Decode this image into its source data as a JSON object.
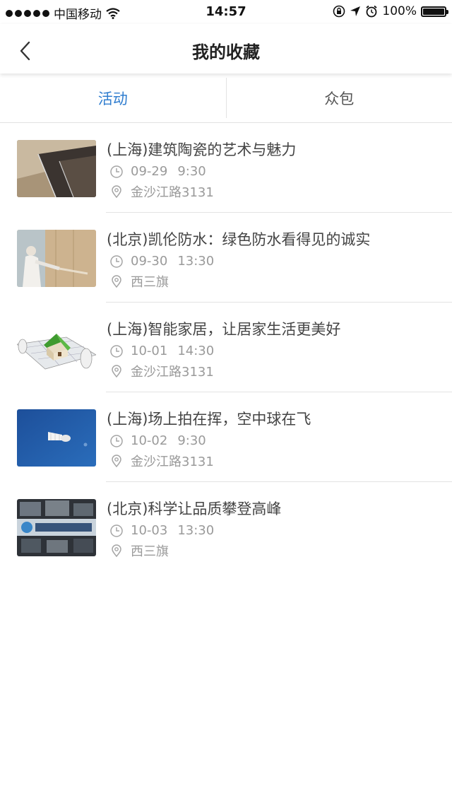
{
  "status_bar": {
    "carrier": "中国移动",
    "time": "14:57",
    "battery": "100%",
    "signal_icon": "signal-dots-icon",
    "wifi_icon": "wifi-icon",
    "orientation_lock_icon": "orientation-lock-icon",
    "location_icon": "location-arrow-icon",
    "alarm_icon": "alarm-icon",
    "battery_icon": "battery-icon"
  },
  "nav": {
    "title": "我的收藏",
    "back_icon": "chevron-left-icon"
  },
  "tabs": [
    {
      "label": "活动",
      "active": true
    },
    {
      "label": "众包",
      "active": false
    }
  ],
  "colors": {
    "accent": "#2f7dcf",
    "text": "#444444",
    "meta": "#9a9a9a",
    "divider": "#e3e3e3"
  },
  "items": [
    {
      "title": "(上海)建筑陶瓷的艺术与魅力",
      "date": "09-29",
      "time": "9:30",
      "location": "金沙江路3131",
      "thumbnail": "ceramic-tiles-image"
    },
    {
      "title": "(北京)凯伦防水：绿色防水看得见的诚实",
      "date": "09-30",
      "time": "13:30",
      "location": "西三旗",
      "thumbnail": "worker-spraying-wall-image"
    },
    {
      "title": "(上海)智能家居，让居家生活更美好",
      "date": "10-01",
      "time": "14:30",
      "location": "金沙江路3131",
      "thumbnail": "house-on-blueprints-image"
    },
    {
      "title": "(上海)场上拍在挥，空中球在飞",
      "date": "10-02",
      "time": "9:30",
      "location": "金沙江路3131",
      "thumbnail": "shuttlecock-sky-image"
    },
    {
      "title": "(北京)科学让品质攀登高峰",
      "date": "10-03",
      "time": "13:30",
      "location": "西三旗",
      "thumbnail": "tech-screens-image"
    }
  ]
}
